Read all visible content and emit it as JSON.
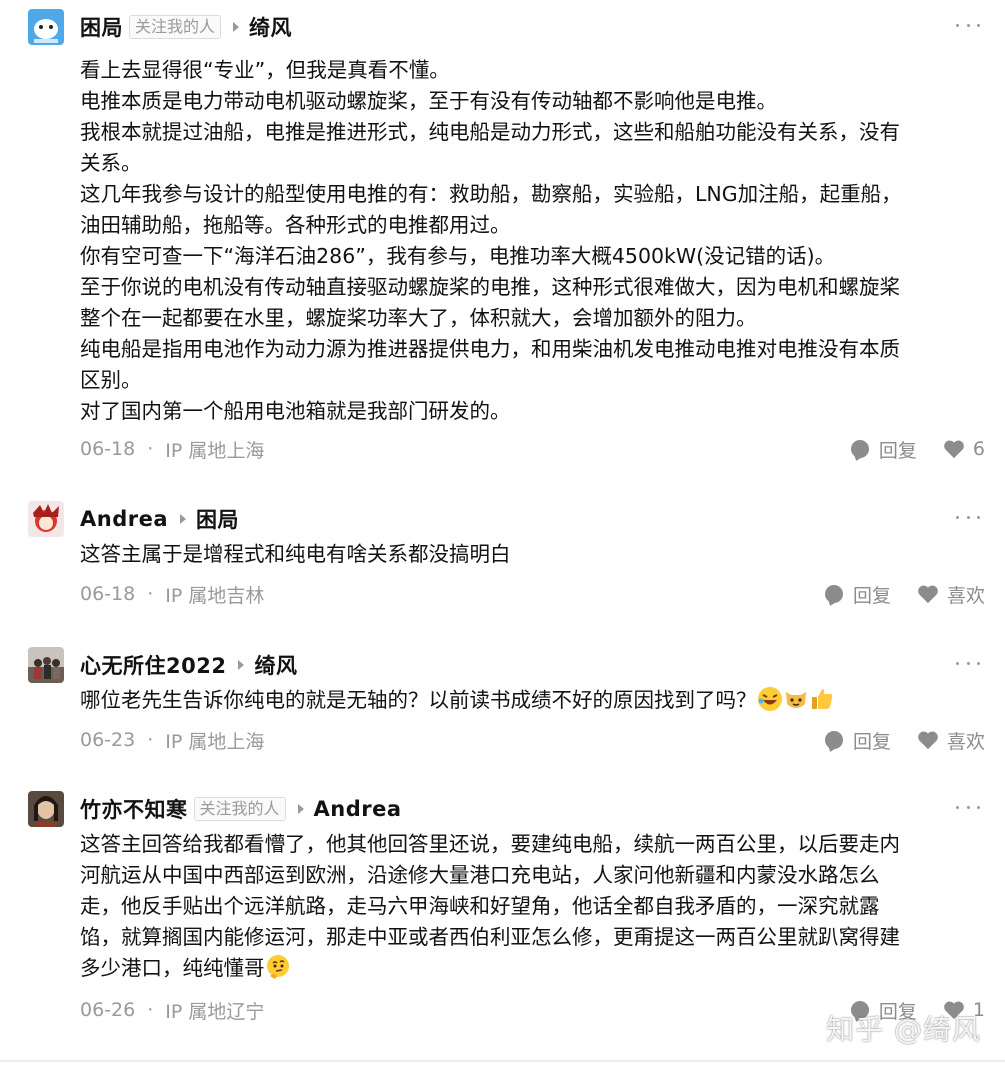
{
  "comments": [
    {
      "author": "困局",
      "author_tag": "关注我的人",
      "reply_to": "绮风",
      "lines": [
        "看上去显得很“专业”，但我是真看不懂。",
        "电推本质是电力带动电机驱动螺旋桨，至于有没有传动轴都不影响他是电推。",
        "我根本就提过油船，电推是推进形式，纯电船是动力形式，这些和船舶功能没有关系，没有",
        "关系。",
        "这几年我参与设计的船型使用电推的有：救助船，勘察船，实验船，LNG加注船，起重船，",
        "油田辅助船，拖船等。各种形式的电推都用过。",
        "你有空可查一下“海洋石油286”，我有参与，电推功率大概4500kW(没记错的话)。",
        "至于你说的电机没有传动轴直接驱动螺旋桨的电推，这种形式很难做大，因为电机和螺旋桨",
        "整个在一起都要在水里，螺旋桨功率大了，体积就大，会增加额外的阻力。",
        "纯电船是指用电池作为动力源为推进器提供电力，和用柴油机发电推动电推对电推没有本质",
        "区别。",
        "对了国内第一个船用电池箱就是我部门研发的。"
      ],
      "date": "06-18",
      "ip": "IP 属地上海",
      "reply_label": "回复",
      "like_label": "6"
    },
    {
      "author": "Andrea",
      "reply_to": "困局",
      "lines": [
        "这答主属于是增程式和纯电有啥关系都没搞明白"
      ],
      "date": "06-18",
      "ip": "IP 属地吉林",
      "reply_label": "回复",
      "like_label": "喜欢"
    },
    {
      "author": "心无所住2022",
      "reply_to": "绮风",
      "lines": [
        "哪位老先生告诉你纯电的就是无轴的？以前读书成绩不好的原因找到了吗？"
      ],
      "emojis": [
        "laugh-cry-emoji",
        "cat-emoji",
        "thumbs-up-emoji"
      ],
      "date": "06-23",
      "ip": "IP 属地上海",
      "reply_label": "回复",
      "like_label": "喜欢"
    },
    {
      "author": "竹亦不知寒",
      "author_tag": "关注我的人",
      "reply_to": "Andrea",
      "lines": [
        "这答主回答给我都看懵了，他其他回答里还说，要建纯电船，续航一两百公里，以后要走内",
        "河航运从中国中西部运到欧洲，沿途修大量港口充电站，人家问他新疆和内蒙没水路怎么",
        "走，他反手贴出个远洋航路，走马六甲海峡和好望角，他话全都自我矛盾的，一深究就露",
        "馅，就算搁国内能修运河，那走中亚或者西伯利亚怎么修，更甭提这一两百公里就趴窝得建",
        "多少港口，纯纯懂哥"
      ],
      "emojis": [
        "thinking-emoji"
      ],
      "date": "06-26",
      "ip": "IP 属地辽宁",
      "reply_label": "回复",
      "like_label": "1"
    }
  ],
  "watermark": "知乎 @绮风",
  "colors": {
    "text": "#121212",
    "meta": "#9a9a9a",
    "icon": "#8c8c8c"
  }
}
